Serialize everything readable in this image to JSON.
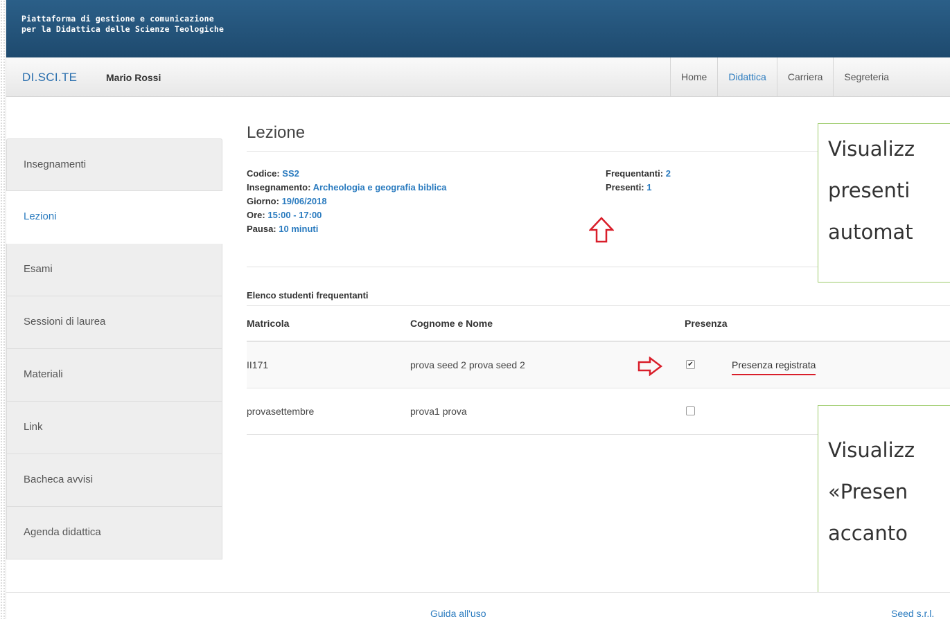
{
  "header": {
    "line1": "Piattaforma di gestione e comunicazione",
    "line2": "per la Didattica delle Scienze Teologiche"
  },
  "navbar": {
    "brand": "DI.SCI.TE",
    "user": "Mario Rossi",
    "links": [
      "Home",
      "Didattica",
      "Carriera",
      "Segreteria"
    ],
    "active_link": "Didattica"
  },
  "sidebar": {
    "items": [
      {
        "label": "Insegnamenti"
      },
      {
        "label": "Lezioni"
      },
      {
        "label": "Esami"
      },
      {
        "label": "Sessioni di laurea"
      },
      {
        "label": "Materiali"
      },
      {
        "label": "Link"
      },
      {
        "label": "Bacheca avvisi"
      },
      {
        "label": "Agenda didattica"
      }
    ],
    "active": "Lezioni"
  },
  "lezione": {
    "title": "Lezione",
    "codice_label": "Codice:",
    "codice": "SS2",
    "insegnamento_label": "Insegnamento:",
    "insegnamento": "Archeologia e geografia biblica",
    "giorno_label": "Giorno:",
    "giorno": "19/06/2018",
    "ore_label": "Ore:",
    "ore": "15:00 - 17:00",
    "pausa_label": "Pausa:",
    "pausa": "10 minuti",
    "frequentanti_label": "Frequentanti:",
    "frequentanti": "2",
    "presenti_label": "Presenti:",
    "presenti": "1"
  },
  "students": {
    "title": "Elenco studenti frequentanti",
    "columns": [
      "Matricola",
      "Cognome e Nome",
      "Presenza"
    ],
    "rows": [
      {
        "matricola": "II171",
        "nome": "prova seed 2 prova seed 2",
        "presente": true,
        "status": "Presenza registrata"
      },
      {
        "matricola": "provasettembre",
        "nome": "prova1 prova",
        "presente": false,
        "status": ""
      }
    ]
  },
  "callouts": {
    "top": [
      "Visualizz",
      "presenti",
      "automat"
    ],
    "bottom": [
      "Visualizz",
      "«Presen",
      "accanto"
    ]
  },
  "footer": {
    "guide": "Guida all'uso",
    "company": "Seed s.r.l."
  },
  "colors": {
    "header_bg": "#245479",
    "link_blue": "#2a7bbf",
    "annotation_red": "#d91e2a",
    "callout_border": "#9ccb6a"
  }
}
